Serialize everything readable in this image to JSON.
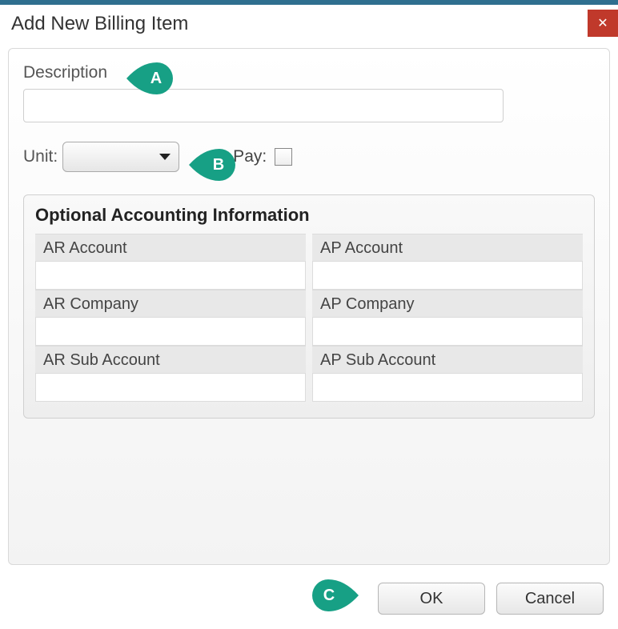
{
  "window": {
    "title": "Add New Billing Item"
  },
  "form": {
    "description_label": "Description",
    "description_value": "",
    "unit_label": "Unit:",
    "unit_value": "",
    "pay_label_suffix": "-Pay:",
    "pay_checked": false
  },
  "accounting": {
    "group_title": "Optional Accounting Information",
    "fields": {
      "ar_account": {
        "label": "AR Account",
        "value": ""
      },
      "ap_account": {
        "label": "AP Account",
        "value": ""
      },
      "ar_company": {
        "label": "AR Company",
        "value": ""
      },
      "ap_company": {
        "label": "AP Company",
        "value": ""
      },
      "ar_sub_account": {
        "label": "AR Sub Account",
        "value": ""
      },
      "ap_sub_account": {
        "label": "AP Sub Account",
        "value": ""
      }
    }
  },
  "buttons": {
    "ok": "OK",
    "cancel": "Cancel"
  },
  "callouts": {
    "a": "A",
    "b": "B",
    "c": "C",
    "color": "#17a085"
  }
}
